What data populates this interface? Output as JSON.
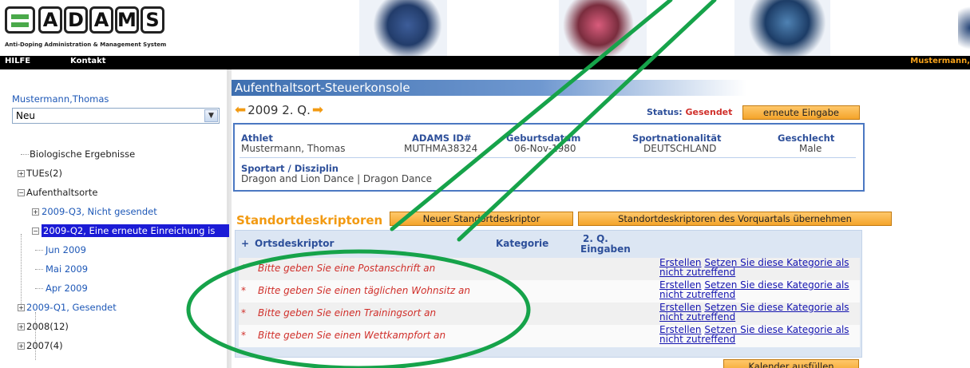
{
  "header": {
    "logo_letters": [
      "A",
      "D",
      "A",
      "M",
      "S"
    ],
    "logo_subtitle": "Anti-Doping Administration & Management System"
  },
  "nav": {
    "help": "HILFE",
    "contact": "Kontakt",
    "user": "Mustermann,"
  },
  "sidebar": {
    "user_name": "Mustermann,Thomas",
    "select_value": "Neu",
    "tree": [
      {
        "label": "Biologische Ergebnisse"
      },
      {
        "label": "TUEs(2)"
      },
      {
        "label": "Aufenthaltsorte"
      },
      {
        "label": "2009-Q3, Nicht gesendet"
      },
      {
        "label": "2009-Q2, Eine erneute Einreichung is"
      },
      {
        "label": "Jun 2009"
      },
      {
        "label": "Mai 2009"
      },
      {
        "label": "Apr 2009"
      },
      {
        "label": "2009-Q1, Gesendet"
      },
      {
        "label": "2008(12)"
      },
      {
        "label": "2007(4)"
      }
    ]
  },
  "main": {
    "title": "Aufenthaltsort-Steuerkonsole",
    "quarter": "2009 2. Q.",
    "status_label": "Status:",
    "status_value": "Gesendet",
    "reenter_button": "erneute Eingabe",
    "athlete": {
      "headers": [
        "Athlet",
        "ADAMS ID#",
        "Geburtsdatum",
        "Sportnationalität",
        "Geschlecht"
      ],
      "values": [
        "Mustermann, Thomas",
        "MUTHMA38324",
        "06-Nov-1980",
        "DEUTSCHLAND",
        "Male"
      ],
      "sport_header": "Sportart / Disziplin",
      "sport_value": "Dragon and Lion Dance | Dragon Dance"
    },
    "descriptors": {
      "title": "Standortdeskriptoren",
      "new_button": "Neuer Standortdeskriptor",
      "take_over_button": "Standortdeskriptoren des Vorquartals übernehmen",
      "columns": {
        "plus": "+",
        "location": "Ortsdeskriptor",
        "category": "Kategorie",
        "entries_line1": "2. Q.",
        "entries_line2": "Eingaben"
      },
      "rows": [
        {
          "text": "Bitte geben Sie eine Postanschrift an"
        },
        {
          "text": "Bitte geben Sie einen täglichen Wohnsitz an"
        },
        {
          "text": "Bitte geben Sie einen Trainingsort an"
        },
        {
          "text": "Bitte geben Sie einen Wettkampfort an"
        }
      ],
      "row_star": "*",
      "action_create": "Erstellen",
      "action_na_line1": "Setzen Sie diese Kategorie als",
      "action_na_line2": "nicht zutreffend"
    },
    "calendar_button": "Kalender ausfüllen"
  },
  "colors": {
    "accent_orange": "#f29a12",
    "title_blue": "#3e6fb0",
    "error_red": "#d0302b",
    "annotation_green": "#16a34a"
  }
}
